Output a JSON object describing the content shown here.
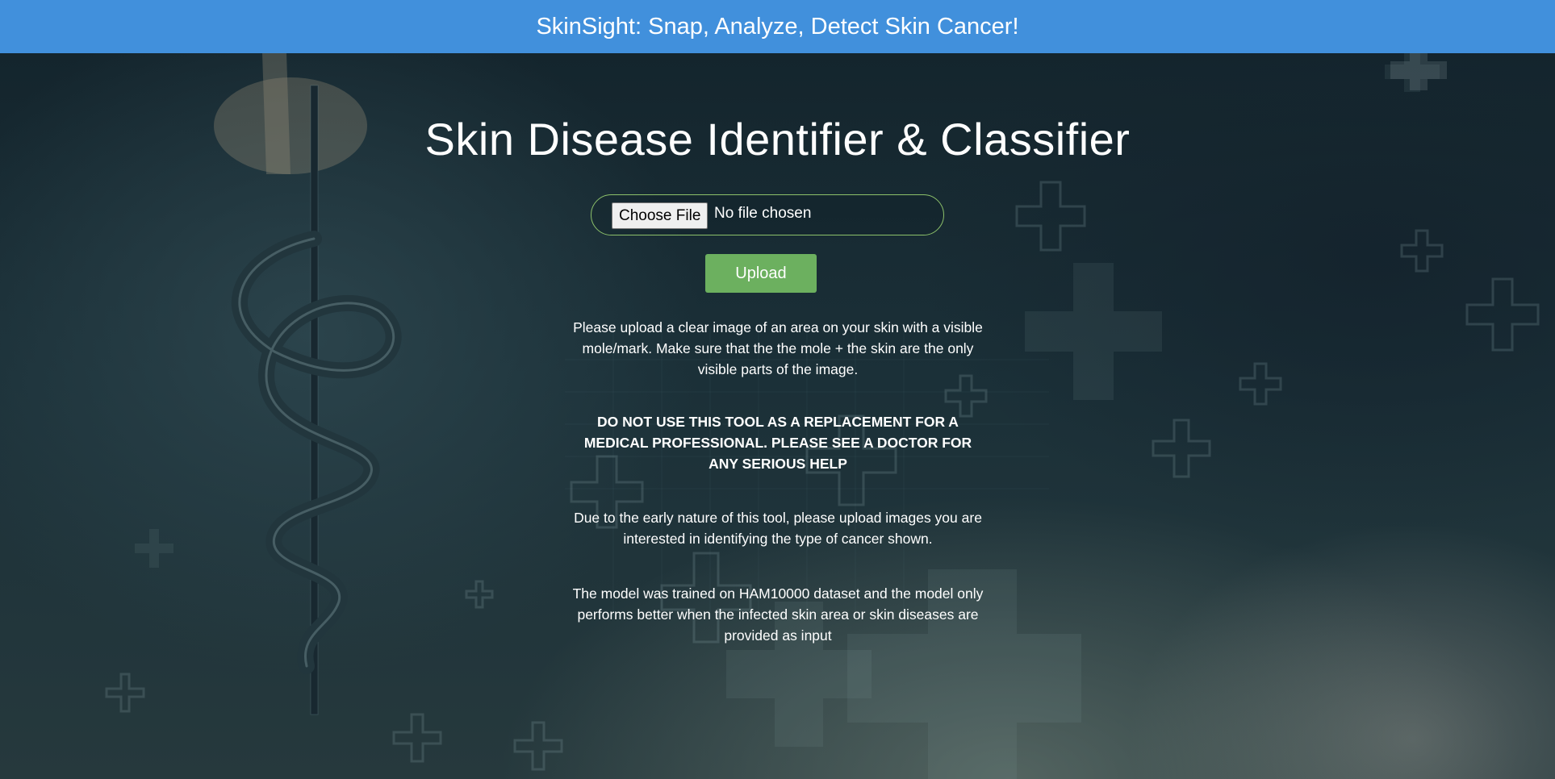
{
  "header": {
    "title": "SkinSight: Snap, Analyze, Detect Skin Cancer!"
  },
  "main": {
    "heading": "Skin Disease Identifier & Classifier",
    "file_input": {
      "button_label": "Choose File",
      "status": "No file chosen"
    },
    "upload_label": "Upload",
    "instructions": "Please upload a clear image of an area on your skin with a visible mole/mark. Make sure that the the mole + the skin are the only visible parts of the image.",
    "warning": "DO NOT USE THIS TOOL AS A REPLACEMENT FOR A MEDICAL PROFESSIONAL. PLEASE SEE A DOCTOR FOR ANY SERIOUS HELP",
    "note": "Due to the early nature of this tool, please upload images you are interested in identifying the type of cancer shown.",
    "model_info": "The model was trained on HAM10000 dataset and the model only performs better when the infected skin area or skin diseases are provided as input"
  },
  "colors": {
    "header_bg": "#4190dc",
    "upload_button": "#6cb05f",
    "file_border": "#8cc06a",
    "page_bg": "#14252d"
  },
  "background": {
    "icons": [
      "caduceus-icon",
      "medical-cross-icon"
    ]
  }
}
